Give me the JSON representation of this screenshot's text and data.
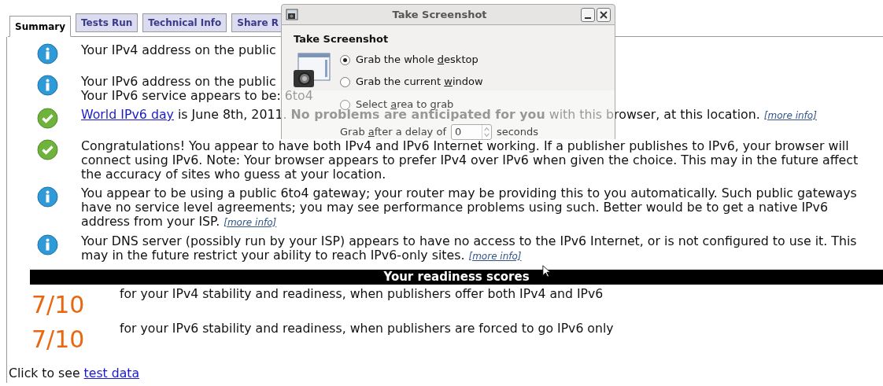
{
  "tabs": [
    {
      "label": "Summary",
      "selected": true
    },
    {
      "label": "Tests Run",
      "selected": false
    },
    {
      "label": "Technical Info",
      "selected": false
    },
    {
      "label": "Share R",
      "selected": false
    }
  ],
  "messages": [
    {
      "kind": "info",
      "paragraphs": [
        "Your IPv4 address on the public"
      ]
    },
    {
      "kind": "info",
      "paragraphs": [
        "Your IPv6 address on the public",
        "Your IPv6 service appears to be: 6to4"
      ]
    },
    {
      "kind": "ok",
      "link": "World IPv6 day",
      "paragraphs": [
        " is June 8th, 2011. **No problems are anticipated for you** with this browser, at this location."
      ],
      "more_info": "[more info]"
    },
    {
      "kind": "ok",
      "paragraphs": [
        "Congratulations! You appear to have both IPv4 and IPv6 Internet working. If a publisher publishes to IPv6, your browser will connect using IPv6. Note: Your browser appears to prefer IPv4 over IPv6 when given the choice. This may in the future affect the accuracy of sites who guess at your location."
      ]
    },
    {
      "kind": "info",
      "paragraphs": [
        "You appear to be using a public 6to4 gateway; your router may be providing this to you automatically. Such public gateways have no service level agreements; you may see performance problems using such. Better would be to get a native IPv6 address from your ISP."
      ],
      "more_info": "[more info]"
    },
    {
      "kind": "info",
      "paragraphs": [
        "Your DNS server (possibly run by your ISP) appears to have no access to the IPv6 Internet, or is not configured to use it. This may in the future restrict your ability to reach IPv6-only sites."
      ],
      "more_info": "[more info]"
    }
  ],
  "scores_title": "Your readiness scores",
  "scores": [
    {
      "score": "7/10",
      "text": "for your IPv4 stability and readiness, when publishers offer both IPv4 and IPv6"
    },
    {
      "score": "7/10",
      "text": "for your IPv6 stability and readiness, when publishers are forced to go IPv6 only"
    }
  ],
  "footer": {
    "text": "Click to see ",
    "link": "test data"
  },
  "dialog": {
    "title": "Take Screenshot",
    "heading": "Take Screenshot",
    "options": [
      {
        "before": "Grab the whole ",
        "key": "d",
        "after": "esktop",
        "selected": true
      },
      {
        "before": "Grab the current ",
        "key": "w",
        "after": "indow",
        "selected": false
      },
      {
        "before": "Select ",
        "key": "a",
        "after": "rea to grab",
        "selected": false
      }
    ],
    "delay": {
      "before": "Grab ",
      "key": "a",
      "after": "fter a delay of",
      "value": "0",
      "unit": "seconds"
    }
  }
}
